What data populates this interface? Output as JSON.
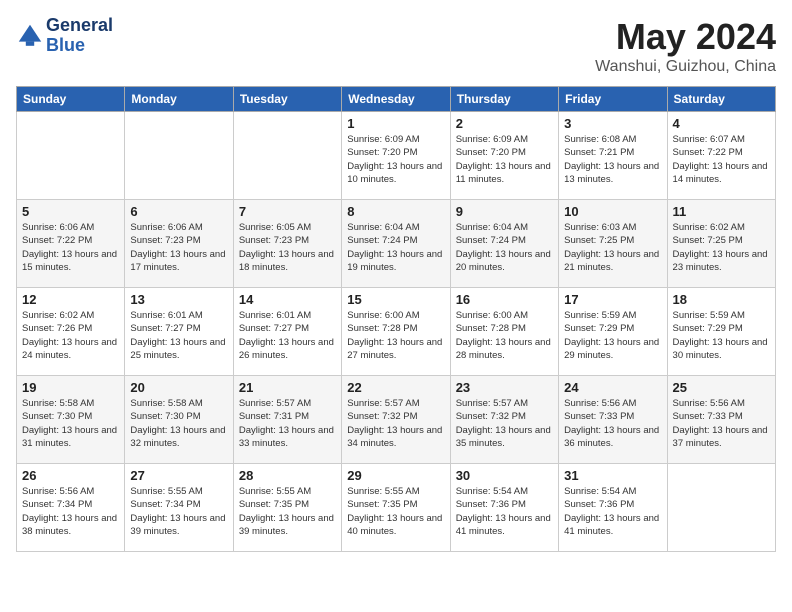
{
  "header": {
    "logo_line1": "General",
    "logo_line2": "Blue",
    "month_year": "May 2024",
    "location": "Wanshui, Guizhou, China"
  },
  "days_of_week": [
    "Sunday",
    "Monday",
    "Tuesday",
    "Wednesday",
    "Thursday",
    "Friday",
    "Saturday"
  ],
  "weeks": [
    [
      {
        "day": "",
        "sunrise": "",
        "sunset": "",
        "daylight": ""
      },
      {
        "day": "",
        "sunrise": "",
        "sunset": "",
        "daylight": ""
      },
      {
        "day": "",
        "sunrise": "",
        "sunset": "",
        "daylight": ""
      },
      {
        "day": "1",
        "sunrise": "Sunrise: 6:09 AM",
        "sunset": "Sunset: 7:20 PM",
        "daylight": "Daylight: 13 hours and 10 minutes."
      },
      {
        "day": "2",
        "sunrise": "Sunrise: 6:09 AM",
        "sunset": "Sunset: 7:20 PM",
        "daylight": "Daylight: 13 hours and 11 minutes."
      },
      {
        "day": "3",
        "sunrise": "Sunrise: 6:08 AM",
        "sunset": "Sunset: 7:21 PM",
        "daylight": "Daylight: 13 hours and 13 minutes."
      },
      {
        "day": "4",
        "sunrise": "Sunrise: 6:07 AM",
        "sunset": "Sunset: 7:22 PM",
        "daylight": "Daylight: 13 hours and 14 minutes."
      }
    ],
    [
      {
        "day": "5",
        "sunrise": "Sunrise: 6:06 AM",
        "sunset": "Sunset: 7:22 PM",
        "daylight": "Daylight: 13 hours and 15 minutes."
      },
      {
        "day": "6",
        "sunrise": "Sunrise: 6:06 AM",
        "sunset": "Sunset: 7:23 PM",
        "daylight": "Daylight: 13 hours and 17 minutes."
      },
      {
        "day": "7",
        "sunrise": "Sunrise: 6:05 AM",
        "sunset": "Sunset: 7:23 PM",
        "daylight": "Daylight: 13 hours and 18 minutes."
      },
      {
        "day": "8",
        "sunrise": "Sunrise: 6:04 AM",
        "sunset": "Sunset: 7:24 PM",
        "daylight": "Daylight: 13 hours and 19 minutes."
      },
      {
        "day": "9",
        "sunrise": "Sunrise: 6:04 AM",
        "sunset": "Sunset: 7:24 PM",
        "daylight": "Daylight: 13 hours and 20 minutes."
      },
      {
        "day": "10",
        "sunrise": "Sunrise: 6:03 AM",
        "sunset": "Sunset: 7:25 PM",
        "daylight": "Daylight: 13 hours and 21 minutes."
      },
      {
        "day": "11",
        "sunrise": "Sunrise: 6:02 AM",
        "sunset": "Sunset: 7:25 PM",
        "daylight": "Daylight: 13 hours and 23 minutes."
      }
    ],
    [
      {
        "day": "12",
        "sunrise": "Sunrise: 6:02 AM",
        "sunset": "Sunset: 7:26 PM",
        "daylight": "Daylight: 13 hours and 24 minutes."
      },
      {
        "day": "13",
        "sunrise": "Sunrise: 6:01 AM",
        "sunset": "Sunset: 7:27 PM",
        "daylight": "Daylight: 13 hours and 25 minutes."
      },
      {
        "day": "14",
        "sunrise": "Sunrise: 6:01 AM",
        "sunset": "Sunset: 7:27 PM",
        "daylight": "Daylight: 13 hours and 26 minutes."
      },
      {
        "day": "15",
        "sunrise": "Sunrise: 6:00 AM",
        "sunset": "Sunset: 7:28 PM",
        "daylight": "Daylight: 13 hours and 27 minutes."
      },
      {
        "day": "16",
        "sunrise": "Sunrise: 6:00 AM",
        "sunset": "Sunset: 7:28 PM",
        "daylight": "Daylight: 13 hours and 28 minutes."
      },
      {
        "day": "17",
        "sunrise": "Sunrise: 5:59 AM",
        "sunset": "Sunset: 7:29 PM",
        "daylight": "Daylight: 13 hours and 29 minutes."
      },
      {
        "day": "18",
        "sunrise": "Sunrise: 5:59 AM",
        "sunset": "Sunset: 7:29 PM",
        "daylight": "Daylight: 13 hours and 30 minutes."
      }
    ],
    [
      {
        "day": "19",
        "sunrise": "Sunrise: 5:58 AM",
        "sunset": "Sunset: 7:30 PM",
        "daylight": "Daylight: 13 hours and 31 minutes."
      },
      {
        "day": "20",
        "sunrise": "Sunrise: 5:58 AM",
        "sunset": "Sunset: 7:30 PM",
        "daylight": "Daylight: 13 hours and 32 minutes."
      },
      {
        "day": "21",
        "sunrise": "Sunrise: 5:57 AM",
        "sunset": "Sunset: 7:31 PM",
        "daylight": "Daylight: 13 hours and 33 minutes."
      },
      {
        "day": "22",
        "sunrise": "Sunrise: 5:57 AM",
        "sunset": "Sunset: 7:32 PM",
        "daylight": "Daylight: 13 hours and 34 minutes."
      },
      {
        "day": "23",
        "sunrise": "Sunrise: 5:57 AM",
        "sunset": "Sunset: 7:32 PM",
        "daylight": "Daylight: 13 hours and 35 minutes."
      },
      {
        "day": "24",
        "sunrise": "Sunrise: 5:56 AM",
        "sunset": "Sunset: 7:33 PM",
        "daylight": "Daylight: 13 hours and 36 minutes."
      },
      {
        "day": "25",
        "sunrise": "Sunrise: 5:56 AM",
        "sunset": "Sunset: 7:33 PM",
        "daylight": "Daylight: 13 hours and 37 minutes."
      }
    ],
    [
      {
        "day": "26",
        "sunrise": "Sunrise: 5:56 AM",
        "sunset": "Sunset: 7:34 PM",
        "daylight": "Daylight: 13 hours and 38 minutes."
      },
      {
        "day": "27",
        "sunrise": "Sunrise: 5:55 AM",
        "sunset": "Sunset: 7:34 PM",
        "daylight": "Daylight: 13 hours and 39 minutes."
      },
      {
        "day": "28",
        "sunrise": "Sunrise: 5:55 AM",
        "sunset": "Sunset: 7:35 PM",
        "daylight": "Daylight: 13 hours and 39 minutes."
      },
      {
        "day": "29",
        "sunrise": "Sunrise: 5:55 AM",
        "sunset": "Sunset: 7:35 PM",
        "daylight": "Daylight: 13 hours and 40 minutes."
      },
      {
        "day": "30",
        "sunrise": "Sunrise: 5:54 AM",
        "sunset": "Sunset: 7:36 PM",
        "daylight": "Daylight: 13 hours and 41 minutes."
      },
      {
        "day": "31",
        "sunrise": "Sunrise: 5:54 AM",
        "sunset": "Sunset: 7:36 PM",
        "daylight": "Daylight: 13 hours and 41 minutes."
      },
      {
        "day": "",
        "sunrise": "",
        "sunset": "",
        "daylight": ""
      }
    ]
  ]
}
